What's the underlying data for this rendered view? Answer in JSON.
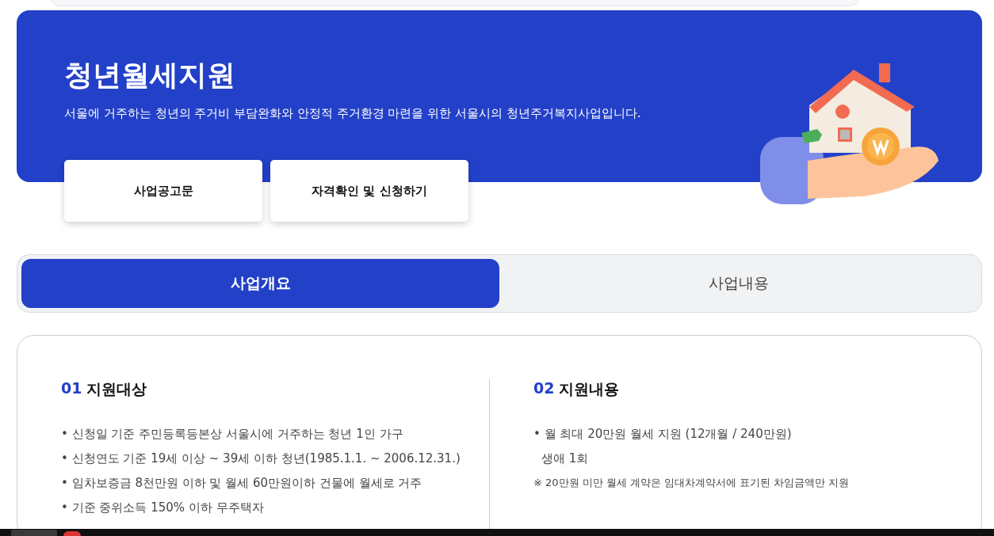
{
  "banner": {
    "title": "청년월세지원",
    "description": "서울에 거주하는 청년의 주거비 부담완화와 안정적 주거환경 마련을 위한 서울시의 청년주거복지사업입니다.",
    "buttons": [
      "사업공고문",
      "자격확인 및 신청하기"
    ]
  },
  "tabs": [
    {
      "label": "사업개요",
      "selected": true
    },
    {
      "label": "사업내용",
      "selected": false
    }
  ],
  "sections": [
    {
      "number": "01",
      "title": "지원대상",
      "items": [
        {
          "text": "• 신청일 기준 주민등록등본상 서울시에 거주하는 청년 1인 가구"
        },
        {
          "text": "• 신청연도 기준 19세 이상 ~ 39세 이하 청년(1985.1.1. ~ 2006.12.31.)"
        },
        {
          "text": "• 임차보증금 8천만원 이하 및 월세 60만원이하 건물에 월세로 거주"
        },
        {
          "text": "• 기준 중위소득 150% 이하 무주택자"
        }
      ]
    },
    {
      "number": "02",
      "title": "지원내용",
      "items": [
        {
          "text": "• 월 최대 20만원 월세 지원 (12개월 / 240만원)",
          "continuation": "생애 1회"
        }
      ],
      "note": "※ 20만원 미만 월세 계약은 임대차계약서에 표기된 차임금액만 지원"
    }
  ]
}
